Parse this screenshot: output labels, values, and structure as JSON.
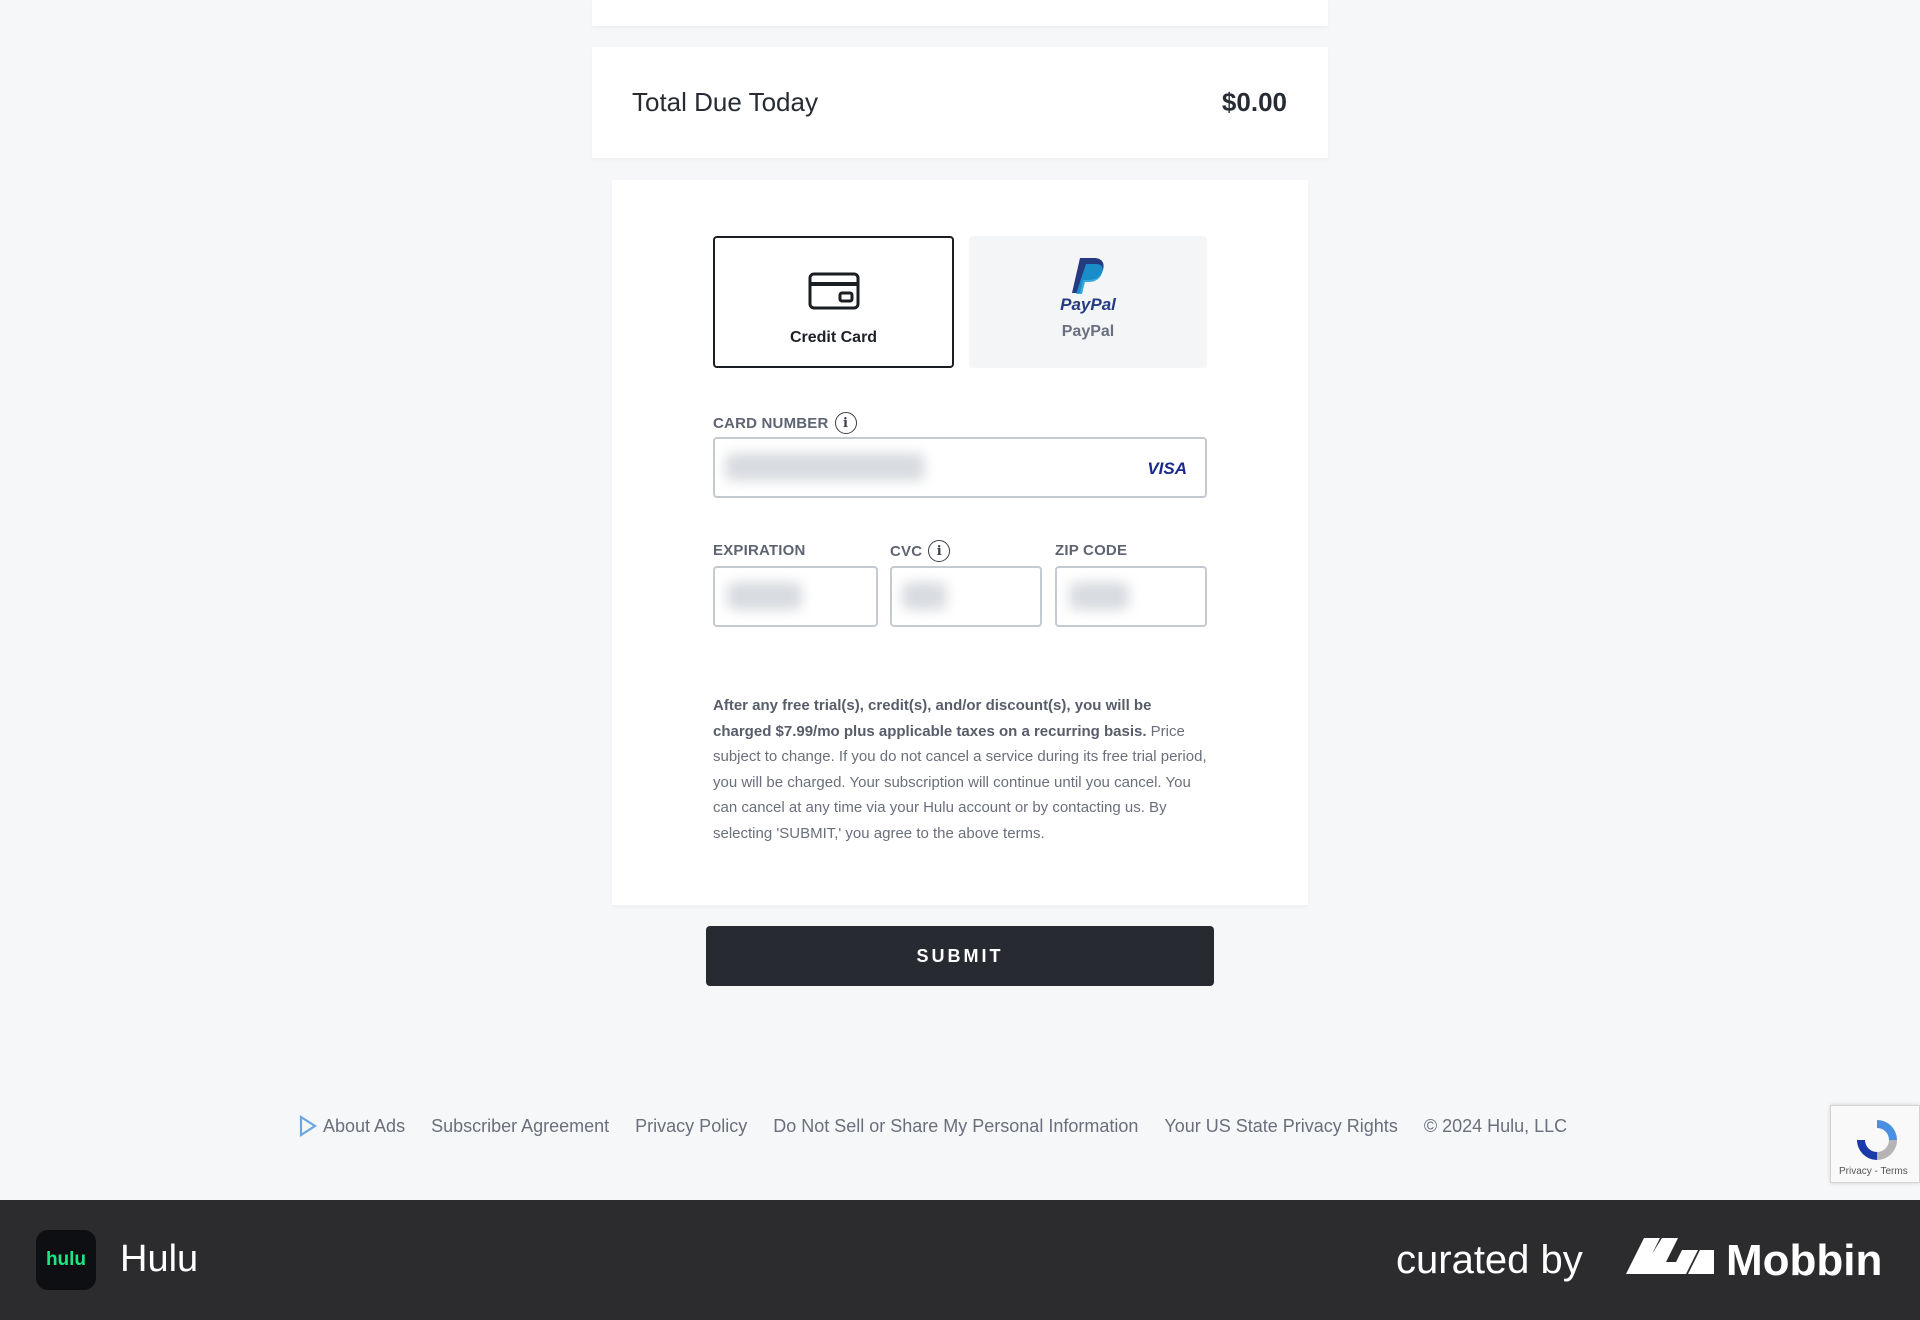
{
  "summary": {
    "total_label": "Total Due Today",
    "total_amount": "$0.00"
  },
  "payment_methods": {
    "credit_card_label": "Credit Card",
    "paypal_label": "PayPal",
    "paypal_logo_text": "PayPal",
    "selected": "Credit Card"
  },
  "fields": {
    "card_number_label": "CARD NUMBER",
    "card_brand": "VISA",
    "expiration_label": "EXPIRATION",
    "cvc_label": "CVC",
    "zip_label": "ZIP CODE",
    "info_glyph": "i"
  },
  "terms": {
    "bold": "After any free trial(s), credit(s), and/or discount(s), you will be charged $7.99/mo plus applicable taxes on a recurring basis.",
    "regular": " Price subject to change. If you do not cancel a service during its free trial period, you will be charged. Your subscription will continue until you cancel. You can cancel at any time via your Hulu account or by contacting us. By selecting 'SUBMIT,' you agree to the above terms."
  },
  "submit_label": "SUBMIT",
  "footer": {
    "links": [
      "About Ads",
      "Subscriber Agreement",
      "Privacy Policy",
      "Do Not Sell or Share My Personal Information",
      "Your US State Privacy Rights"
    ],
    "copyright": "© 2024 Hulu, LLC"
  },
  "recaptcha": {
    "text": "Privacy - Terms"
  },
  "bottom_bar": {
    "app_logo_text": "hulu",
    "app_name": "Hulu",
    "curated_by": "curated by",
    "brand": "Mobbin"
  },
  "colors": {
    "page_bg": "#f6f7f9",
    "submit_bg": "#272a31",
    "hulu_green": "#1ce783",
    "visa_blue": "#1a2a8c"
  }
}
